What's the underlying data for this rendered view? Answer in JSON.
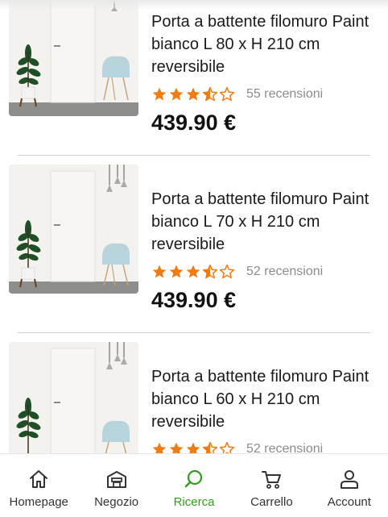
{
  "products": [
    {
      "title": "Porta a battente filomuro Paint bianco L 80 x H 210 cm reversibile",
      "rating": 3.5,
      "reviews": "55 recensioni",
      "price": "439.90 €"
    },
    {
      "title": "Porta a battente filomuro Paint bianco L 70 x H 210 cm reversibile",
      "rating": 3.5,
      "reviews": "52 recensioni",
      "price": "439.90 €"
    },
    {
      "title": "Porta a battente filomuro Paint bianco L 60 x H 210 cm reversibile",
      "rating": 3.5,
      "reviews": "52 recensioni",
      "price": ""
    }
  ],
  "bottom_nav": {
    "items": [
      {
        "label": "Homepage",
        "icon": "home-icon"
      },
      {
        "label": "Negozio",
        "icon": "store-icon"
      },
      {
        "label": "Ricerca",
        "icon": "search-icon",
        "active": true
      },
      {
        "label": "Carrello",
        "icon": "cart-icon"
      },
      {
        "label": "Account",
        "icon": "account-icon"
      }
    ]
  },
  "colors": {
    "star": "#f07c13",
    "active_nav": "#2e9f1b",
    "review_text": "#8c8c8c",
    "divider": "#cfcfcf"
  }
}
